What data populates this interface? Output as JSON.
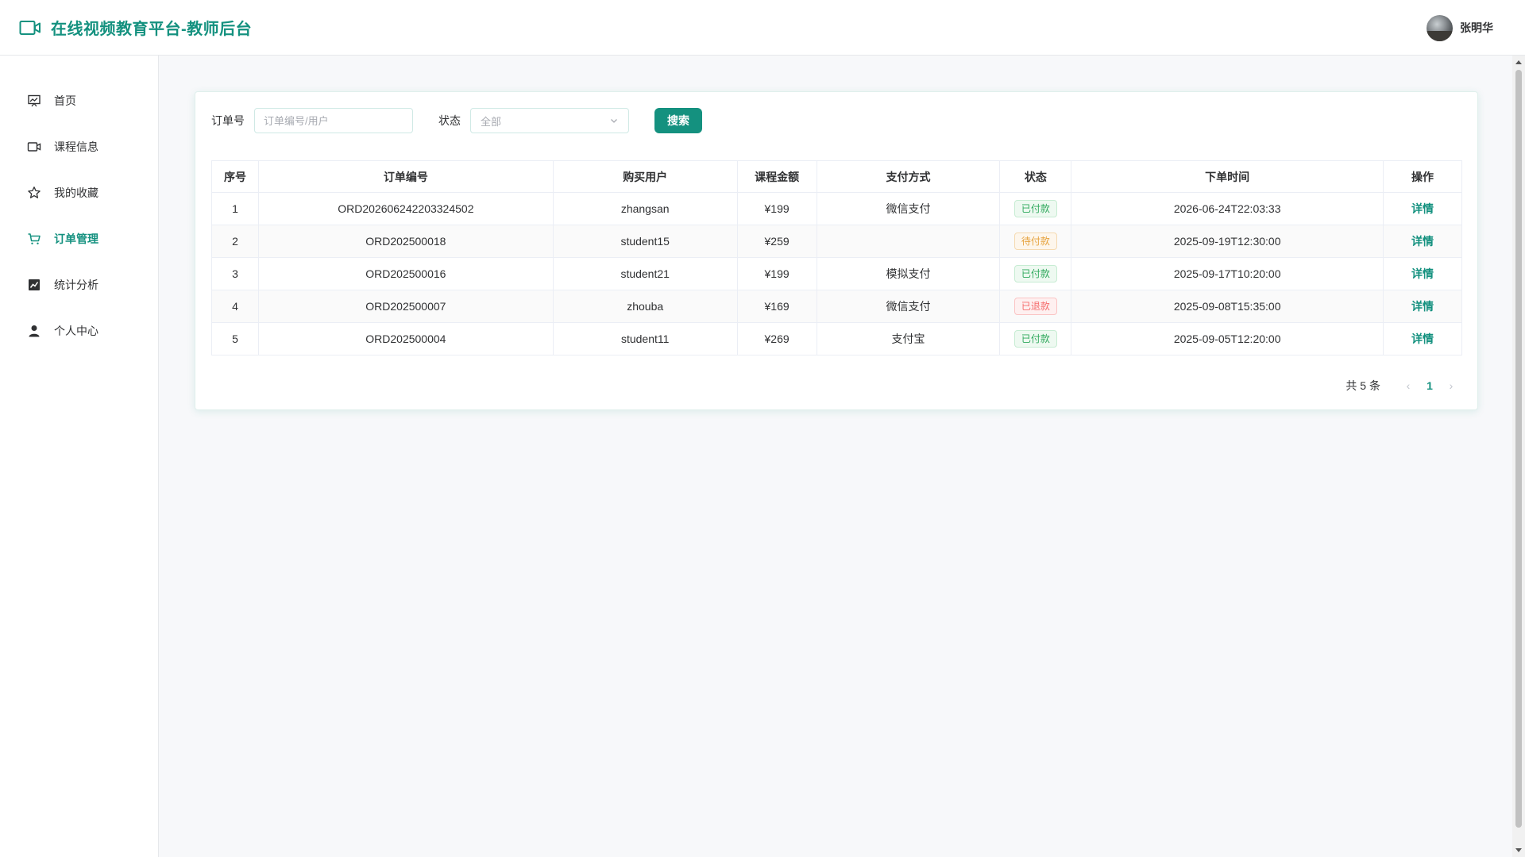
{
  "header": {
    "title": "在线视频教育平台-教师后台",
    "user_name": "张明华"
  },
  "sidebar": {
    "items": [
      {
        "label": "首页",
        "icon": "dashboard-icon",
        "active": false
      },
      {
        "label": "课程信息",
        "icon": "video-camera-icon",
        "active": false
      },
      {
        "label": "我的收藏",
        "icon": "star-icon",
        "active": false
      },
      {
        "label": "订单管理",
        "icon": "cart-icon",
        "active": true
      },
      {
        "label": "统计分析",
        "icon": "chart-icon",
        "active": false
      },
      {
        "label": "个人中心",
        "icon": "user-icon",
        "active": false
      }
    ]
  },
  "filter": {
    "order_label": "订单号",
    "order_placeholder": "订单编号/用户",
    "status_label": "状态",
    "status_value": "全部",
    "search_label": "搜索"
  },
  "table": {
    "columns": [
      "序号",
      "订单编号",
      "购买用户",
      "课程金额",
      "支付方式",
      "状态",
      "下单时间",
      "操作"
    ],
    "rows": [
      {
        "index": "1",
        "order_no": "ORD202606242203324502",
        "user": "zhangsan",
        "amount": "¥199",
        "payment": "微信支付",
        "status": "已付款",
        "status_type": "paid",
        "time": "2026-06-24T22:03:33",
        "action": "详情"
      },
      {
        "index": "2",
        "order_no": "ORD202500018",
        "user": "student15",
        "amount": "¥259",
        "payment": "",
        "status": "待付款",
        "status_type": "pending",
        "time": "2025-09-19T12:30:00",
        "action": "详情"
      },
      {
        "index": "3",
        "order_no": "ORD202500016",
        "user": "student21",
        "amount": "¥199",
        "payment": "模拟支付",
        "status": "已付款",
        "status_type": "paid",
        "time": "2025-09-17T10:20:00",
        "action": "详情"
      },
      {
        "index": "4",
        "order_no": "ORD202500007",
        "user": "zhouba",
        "amount": "¥169",
        "payment": "微信支付",
        "status": "已退款",
        "status_type": "refunded",
        "time": "2025-09-08T15:35:00",
        "action": "详情"
      },
      {
        "index": "5",
        "order_no": "ORD202500004",
        "user": "student11",
        "amount": "¥269",
        "payment": "支付宝",
        "status": "已付款",
        "status_type": "paid",
        "time": "2025-09-05T12:20:00",
        "action": "详情"
      }
    ]
  },
  "pagination": {
    "total_text": "共 5 条",
    "current_page": "1"
  },
  "colors": {
    "brand": "#14917f",
    "paid": "#2fa95c",
    "pending": "#e6a23c",
    "refunded": "#f56c6c"
  }
}
